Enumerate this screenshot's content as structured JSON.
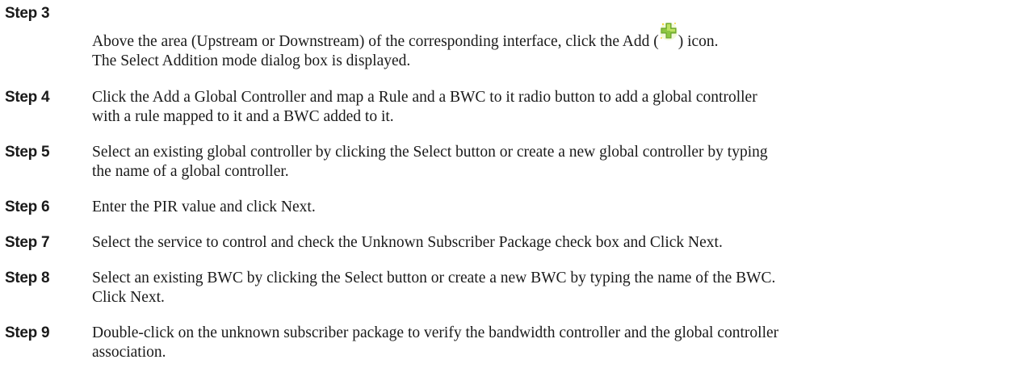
{
  "steps": [
    {
      "label": "Step 3",
      "lines": [
        {
          "before_icon": "Above the area (Upstream or Downstream) of the corresponding interface, click the Add (",
          "icon": "add-plus-icon",
          "after_icon": ") icon."
        },
        "The Select Addition mode dialog box is displayed."
      ]
    },
    {
      "label": "Step 4",
      "lines": [
        "Click the Add a Global Controller and map a Rule and a BWC to it radio button to add a global controller",
        "with a rule mapped to it and a BWC added to it."
      ]
    },
    {
      "label": "Step 5",
      "lines": [
        "Select an existing global controller by clicking the Select button or create a new global controller by typing",
        "the name of a global controller."
      ]
    },
    {
      "label": "Step 6",
      "lines": [
        "Enter the PIR value and click Next."
      ]
    },
    {
      "label": "Step 7",
      "lines": [
        "Select the service to control and check the Unknown Subscriber Package check box and Click Next."
      ]
    },
    {
      "label": "Step 8",
      "lines": [
        "Select an existing BWC by clicking the Select button or create a new BWC by typing the name of the BWC.",
        "Click Next."
      ]
    },
    {
      "label": "Step 9",
      "lines": [
        "Double-click on the unknown subscriber package to verify the bandwidth controller and the global controller",
        "association."
      ]
    }
  ],
  "colors": {
    "text": "#1a1a1a",
    "icon_green": "#8cc63f",
    "icon_yellow": "#f2d53c"
  }
}
